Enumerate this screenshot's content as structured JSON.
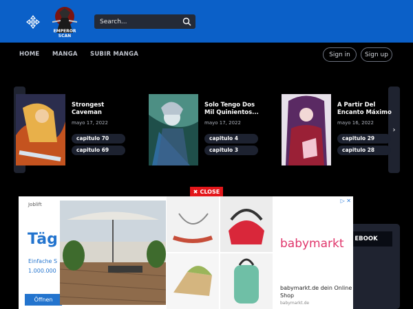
{
  "search": {
    "placeholder": "Search..."
  },
  "logo": {
    "text": "EMPEROR SCAN"
  },
  "nav": {
    "items": [
      "HOME",
      "MANGA",
      "SUBIR MANGA"
    ],
    "sign_in": "Sign in",
    "sign_up": "Sign up"
  },
  "cards": [
    {
      "title": "Strongest Caveman",
      "date": "mayo 17, 2022",
      "chapters": [
        "capitulo 70",
        "capitulo 69"
      ]
    },
    {
      "title": "Solo Tengo Dos Mil Quinientos...",
      "date": "mayo 17, 2022",
      "chapters": [
        "capitulo 4",
        "capitulo 3"
      ]
    },
    {
      "title": "A Partir Del Encanto Máximo",
      "date": "mayo 16, 2022",
      "chapters": [
        "capitulo 29",
        "capitulo 28"
      ]
    }
  ],
  "ad": {
    "close_label": "CLOSE",
    "left": {
      "brand": "Joblift",
      "headline": "Täg",
      "line1": "Einfache S",
      "line2": "1.000.000",
      "cta": "Öffnen"
    },
    "right": {
      "logo": "babymarkt",
      "caption": "babymarkt.de dein Online Shop",
      "domain": "babymarkt.de"
    }
  },
  "facebook_label": "EBOOK",
  "colors": {
    "topbar": "#0b60c8",
    "background": "#000000",
    "ad_close": "#e3161a",
    "accent_blue": "#2374ce"
  }
}
